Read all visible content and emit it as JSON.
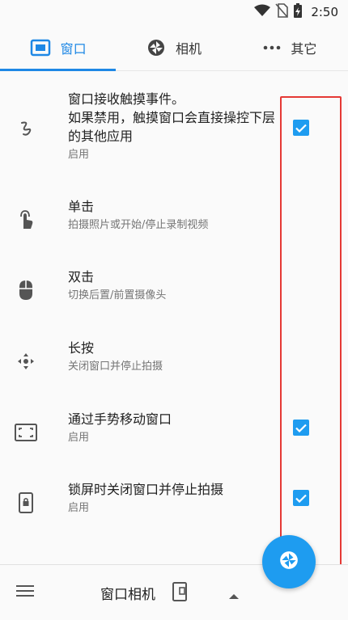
{
  "status": {
    "time": "2:50"
  },
  "tabs": [
    {
      "label": "窗口",
      "icon": "window-icon",
      "active": true
    },
    {
      "label": "相机",
      "icon": "aperture-icon",
      "active": false
    },
    {
      "label": "其它",
      "icon": "more-horizontal-icon",
      "active": false
    }
  ],
  "settings": [
    {
      "title": "窗口接收触摸事件。\n如果禁用，触摸窗口会直接操控下层的其他应用",
      "subtitle": "启用",
      "icon": "gesture-icon",
      "checked": true
    },
    {
      "title": "单击",
      "subtitle": "拍摄照片或开始/停止录制视频",
      "icon": "touch-icon",
      "checked": false
    },
    {
      "title": "双击",
      "subtitle": "切换后置/前置摄像头",
      "icon": "mouse-icon",
      "checked": false
    },
    {
      "title": "长按",
      "subtitle": "关闭窗口并停止拍摄",
      "icon": "move-arrows-icon",
      "checked": false
    },
    {
      "title": "通过手势移动窗口",
      "subtitle": "启用",
      "icon": "screen-frame-icon",
      "checked": true
    },
    {
      "title": "锁屏时关闭窗口并停止拍摄",
      "subtitle": "启用",
      "icon": "lock-phone-icon",
      "checked": true
    }
  ],
  "bottom": {
    "title": "窗口相机"
  },
  "colors": {
    "accent": "#1e88e5",
    "checkbox": "#1e9cf0",
    "highlight": "#e53935"
  }
}
